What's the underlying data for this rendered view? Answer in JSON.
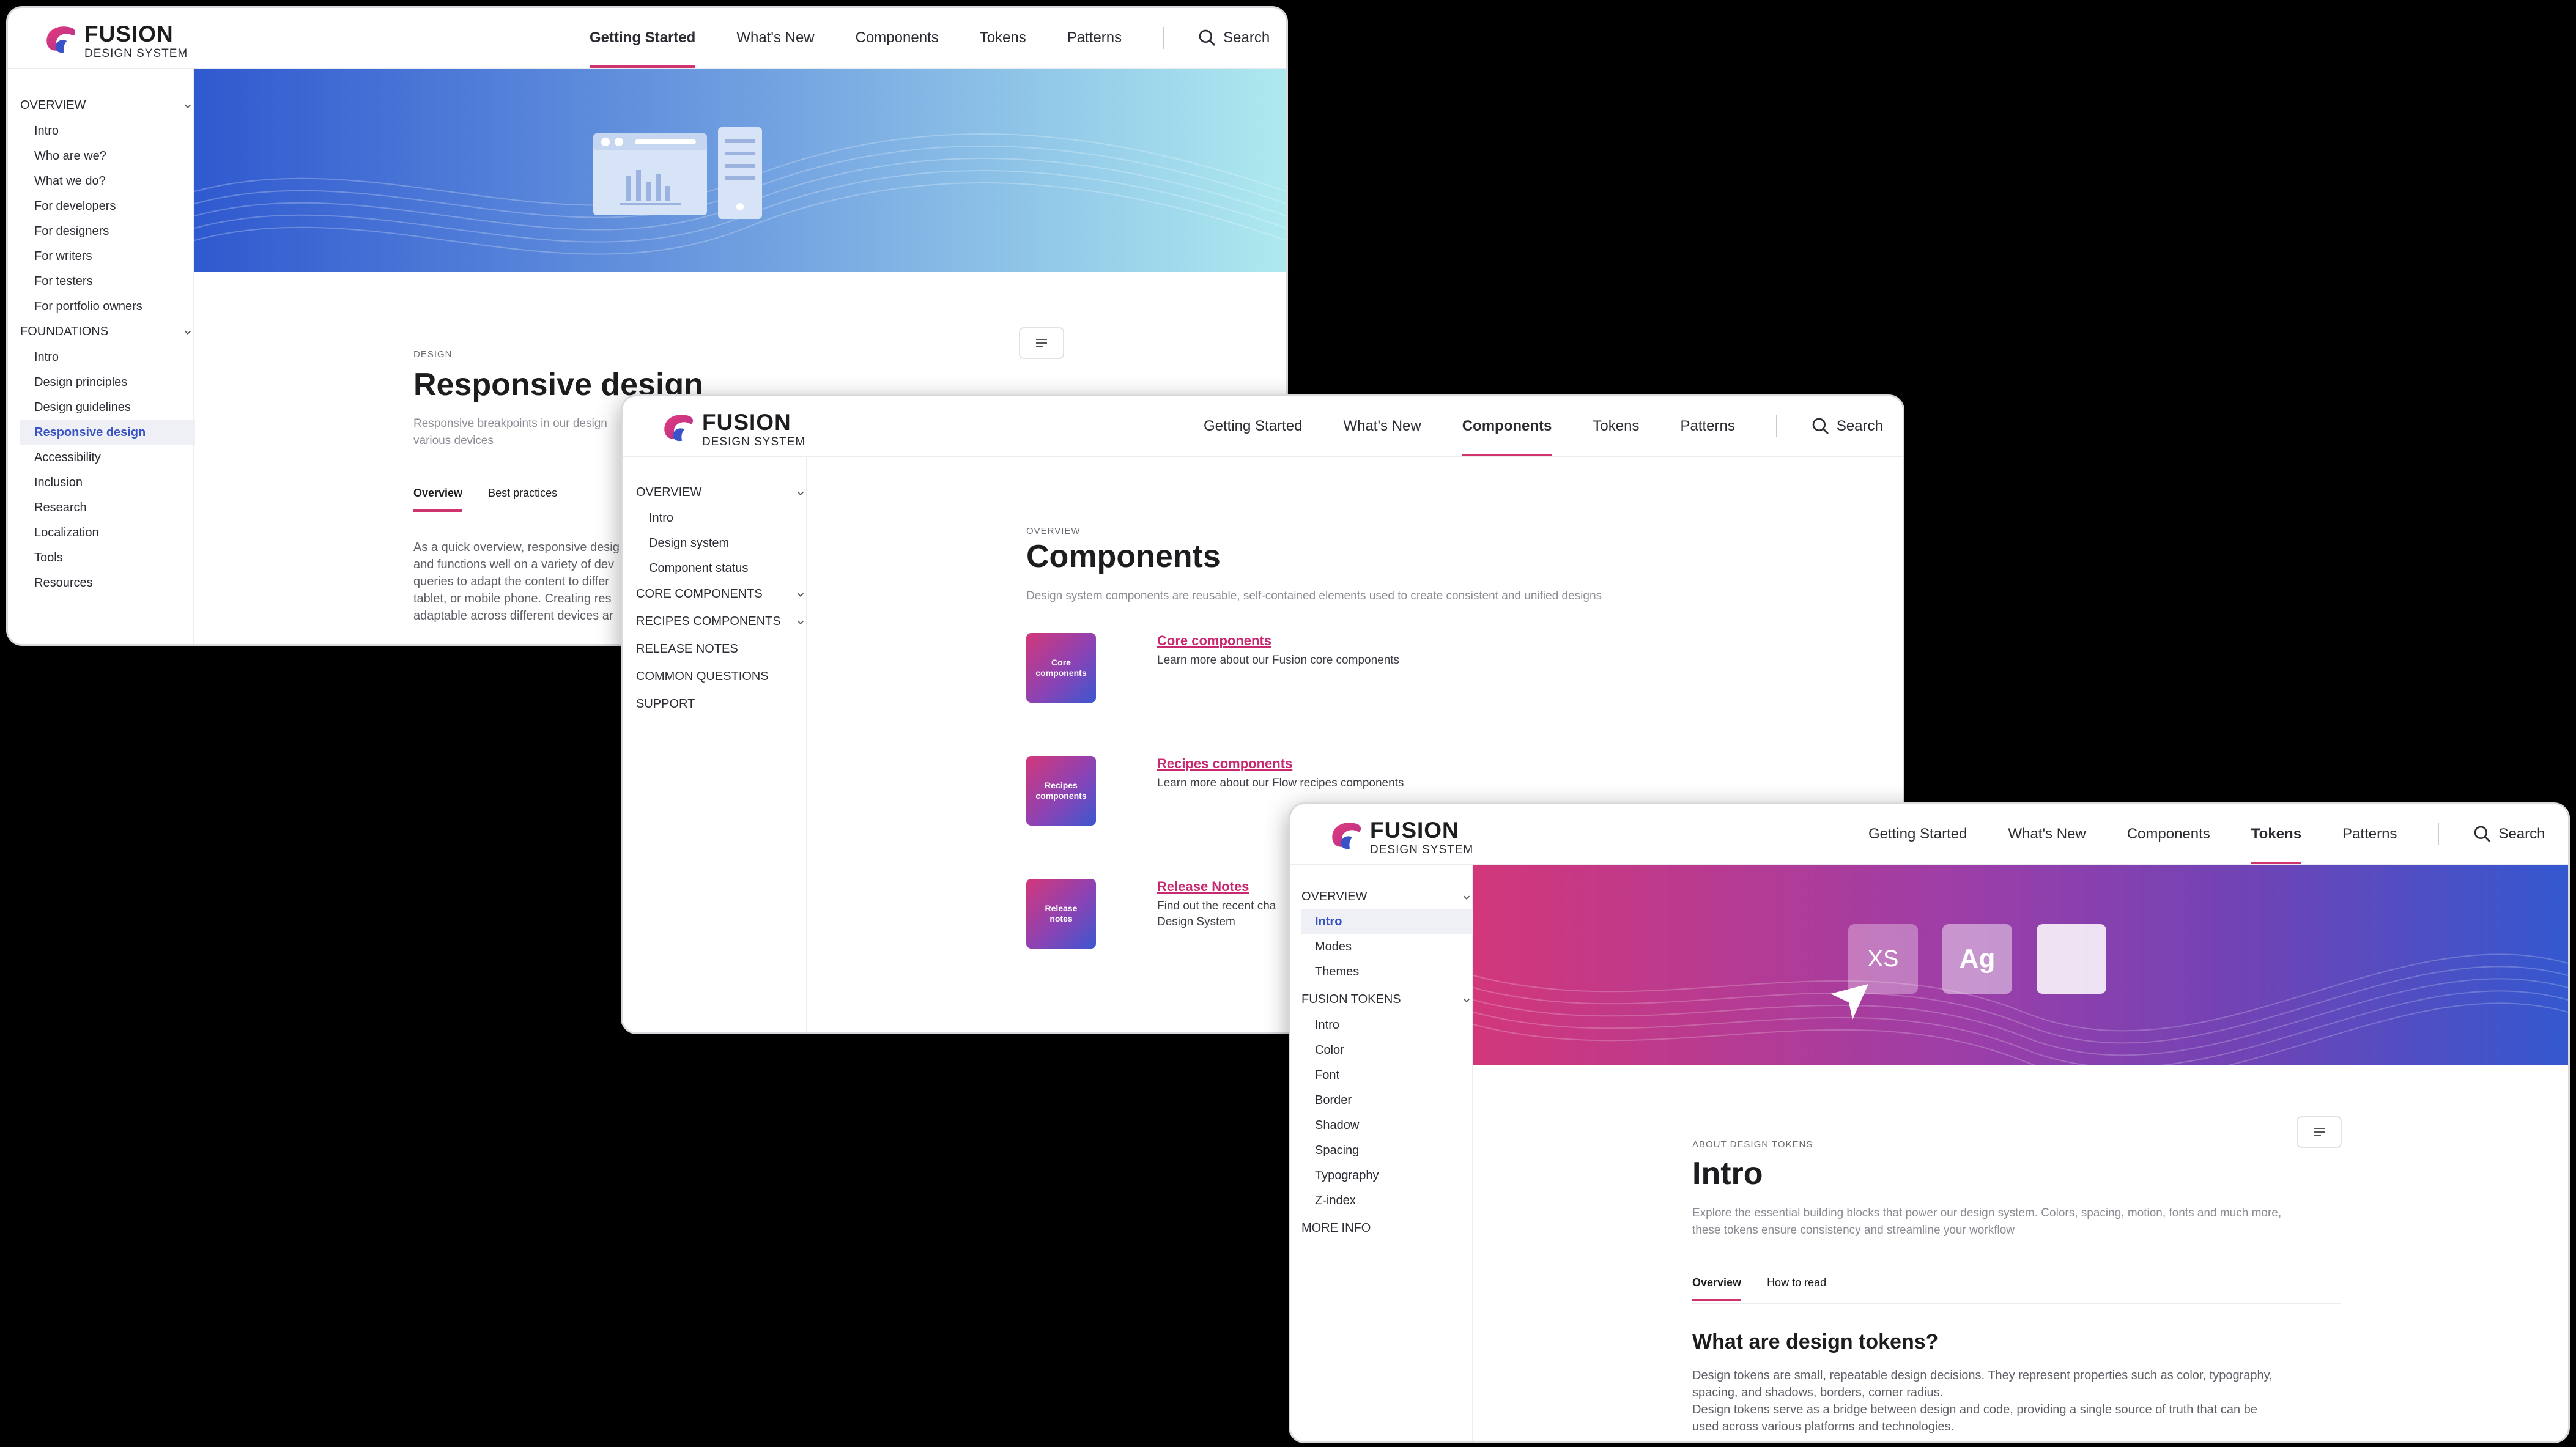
{
  "brand": {
    "name": "FUSION",
    "tagline": "DESIGN SYSTEM"
  },
  "nav": {
    "getting_started": "Getting Started",
    "whats_new": "What's New",
    "components": "Components",
    "tokens": "Tokens",
    "patterns": "Patterns",
    "search": "Search"
  },
  "colors": {
    "accent": "#d0346f",
    "link": "#c8286f",
    "selected": "#3953c4"
  },
  "window1": {
    "sidebar": {
      "overview": "OVERVIEW",
      "overview_items": [
        "Intro",
        "Who are we?",
        "What we do?",
        "For developers",
        "For designers",
        "For writers",
        "For testers",
        "For portfolio owners"
      ],
      "foundations": "FOUNDATIONS",
      "foundations_items": [
        "Intro",
        "Design principles",
        "Design guidelines",
        "Responsive design",
        "Accessibility",
        "Inclusion",
        "Research",
        "Localization",
        "Tools",
        "Resources"
      ]
    },
    "eyebrow": "DESIGN",
    "title": "Responsive design",
    "lead": "Responsive breakpoints in our design\nvarious devices",
    "tabs": [
      "Overview",
      "Best practices"
    ],
    "body": "As a quick overview, responsive desig\nand functions well on a variety of dev\nqueries to adapt the content to differ\ntablet, or mobile phone. Creating res\nadaptable across different devices ar"
  },
  "window2": {
    "sidebar": {
      "overview": "OVERVIEW",
      "overview_items": [
        "Intro",
        "Design system",
        "Component status"
      ],
      "core": "CORE COMPONENTS",
      "recipes": "RECIPES COMPONENTS",
      "release": "RELEASE NOTES",
      "questions": "COMMON QUESTIONS",
      "support": "SUPPORT"
    },
    "eyebrow": "OVERVIEW",
    "title": "Components",
    "lead": "Design system components are reusable, self-contained elements used to create consistent and unified designs",
    "cards": [
      {
        "thumb": "Core\ncomponents",
        "link": "Core components",
        "desc": "Learn more about our Fusion core components"
      },
      {
        "thumb": "Recipes\ncomponents",
        "link": "Recipes components",
        "desc": "Learn more about our Flow recipes components"
      },
      {
        "thumb": "Release\nnotes",
        "link": "Release Notes",
        "desc": "Find out the recent cha\nDesign System"
      }
    ]
  },
  "window3": {
    "sidebar": {
      "overview": "OVERVIEW",
      "overview_items": [
        "Intro",
        "Modes",
        "Themes"
      ],
      "tokens": "FUSION TOKENS",
      "tokens_items": [
        "Intro",
        "Color",
        "Font",
        "Border",
        "Shadow",
        "Spacing",
        "Typography",
        "Z-index"
      ],
      "more": "MORE INFO"
    },
    "hero": {
      "tile1": "XS",
      "tile2": "Ag"
    },
    "eyebrow": "ABOUT DESIGN TOKENS",
    "title": "Intro",
    "lead": "Explore the essential building blocks that power our design system. Colors, spacing, motion, fonts and much more,\nthese tokens ensure consistency and streamline your workflow",
    "tabs": [
      "Overview",
      "How to read"
    ],
    "h2": "What are design tokens?",
    "body": "Design tokens are small, repeatable design decisions. They represent properties such as color, typography,\nspacing, and shadows, borders, corner radius.\nDesign tokens serve as a bridge between design and code, providing a single source of truth that can be\nused across various platforms and technologies."
  }
}
